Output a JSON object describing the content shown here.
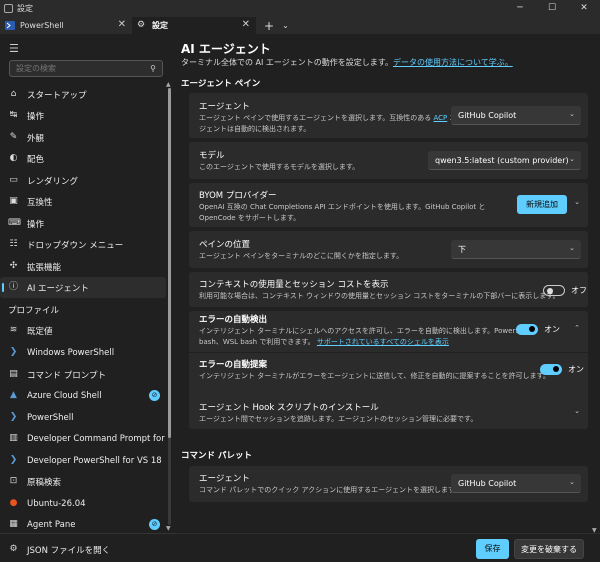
{
  "window": {
    "title": "設定",
    "minimize": "─",
    "maximize": "☐",
    "close": "✕"
  },
  "tabs": [
    {
      "label": "PowerShell",
      "close": "✕"
    },
    {
      "label": "設定",
      "close": "✕"
    }
  ],
  "tabbar": {
    "new_tab": "+",
    "dropdown": "⌄"
  },
  "sidebar": {
    "search_placeholder": "設定の検索",
    "items": [
      {
        "label": "スタートアップ",
        "icon": "home-icon"
      },
      {
        "label": "操作",
        "icon": "interaction-icon"
      },
      {
        "label": "外観",
        "icon": "pen-icon"
      },
      {
        "label": "配色",
        "icon": "palette-icon"
      },
      {
        "label": "レンダリング",
        "icon": "monitor-icon"
      },
      {
        "label": "互換性",
        "icon": "compat-icon"
      },
      {
        "label": "操作",
        "icon": "keyboard-icon"
      },
      {
        "label": "ドロップダウン メニュー",
        "icon": "list-icon"
      },
      {
        "label": "拡張機能",
        "icon": "puzzle-icon"
      },
      {
        "label": "AI エージェント",
        "icon": "info-icon"
      }
    ],
    "profiles_header": "プロファイル",
    "profiles": [
      {
        "label": "既定値",
        "icon": "layers-icon"
      },
      {
        "label": "Windows PowerShell",
        "icon": "powershell-icon"
      },
      {
        "label": "コマンド プロンプト",
        "icon": "cmd-icon"
      },
      {
        "label": "Azure Cloud Shell",
        "icon": "azure-icon",
        "badge": "⊘"
      },
      {
        "label": "PowerShell",
        "icon": "powershell-icon"
      },
      {
        "label": "Developer Command Prompt for",
        "icon": "dev-cmd-icon"
      },
      {
        "label": "Developer PowerShell for VS 18",
        "icon": "dev-ps-icon"
      },
      {
        "label": "原稿検索",
        "icon": "search-doc-icon"
      },
      {
        "label": "Ubuntu-26.04",
        "icon": "ubuntu-icon"
      },
      {
        "label": "Agent Pane",
        "icon": "agent-icon",
        "badge": "⊘"
      }
    ],
    "open_json": "JSON ファイルを開く"
  },
  "main": {
    "title": "AI エージェント",
    "description": "ターミナル全体での AI エージェントの動作を設定します。",
    "description_link": "データの使用方法について学ぶ。",
    "section_pane": "エージェント ペイン",
    "agent": {
      "title": "エージェント",
      "desc1": "エージェント ペインで使用するエージェントを選択します。互換性のある",
      "desc_link": "ACP",
      "desc2": "エー",
      "desc3": "ジェントは自動的に検出されます。",
      "value": "GitHub Copilot"
    },
    "model": {
      "title": "モデル",
      "desc": "このエージェントで使用するモデルを選択します。",
      "value": "qwen3.5:latest (custom provider)"
    },
    "byom": {
      "title": "BYOM プロバイダー",
      "desc1": "OpenAI 互換の Chat Completions API エンドポイントを使用します。GitHub Copilot と",
      "desc2": "OpenCode をサポートします。",
      "button": "新規追加"
    },
    "position": {
      "title": "ペインの位置",
      "desc": "エージェント ペインをターミナルのどこに開くかを指定します。",
      "value": "下"
    },
    "context": {
      "title": "コンテキストの使用量とセッション コストを表示",
      "desc": "利用可能な場合は、コンテキスト ウィンドウの使用量とセッション コストをターミナルの下部バーに表示します。",
      "state": "オフ"
    },
    "error_detect": {
      "title": "エラーの自動検出",
      "desc1": "インテリジェント ターミナルにシェルへのアクセスを許可し、エラーを自動的に検出します。PowerShell、",
      "desc2": "bash、WSL bash で利用できます。",
      "desc_link": "サポートされているすべてのシェルを表示",
      "state": "オン"
    },
    "error_suggest": {
      "title": "エラーの自動提案",
      "desc": "インテリジェント ターミナルがエラーをエージェントに送信して、修正を自動的に提案することを許可します。",
      "state": "オン"
    },
    "hook": {
      "title": "エージェント Hook スクリプトのインストール",
      "desc": "エージェント間でセッションを追跡します。エージェントのセッション管理に必要です。"
    },
    "section_palette": "コマンド パレット",
    "palette_agent": {
      "title": "エージェント",
      "desc": "コマンド パレットでのクイック アクションに使用するエージェントを選択します。",
      "value": "GitHub Copilot"
    },
    "save": "保存",
    "discard": "変更を破棄する"
  },
  "colors": {
    "accent": "#60cdff",
    "background": "#202020",
    "card": "#2b2b2b"
  }
}
